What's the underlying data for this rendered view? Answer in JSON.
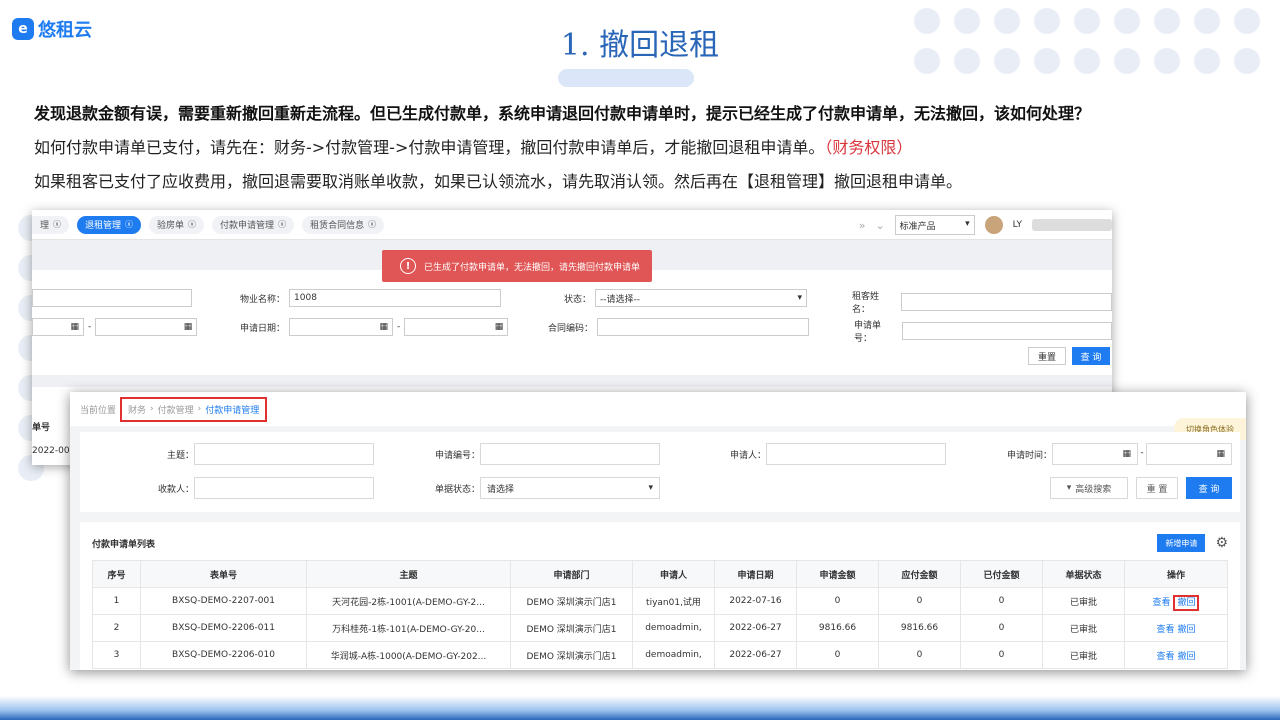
{
  "brand": {
    "logo_mark": "e",
    "name": "悠租云"
  },
  "slide": {
    "title": "1. 撤回退租",
    "question": "发现退款金额有误，需要重新撤回重新走流程。但已生成付款单，系统申请退回付款申请单时，提示已经生成了付款申请单，无法撤回，该如何处理？",
    "answer1_text": "如何付款申请单已支付，请先在：财务->付款管理->付款申请管理，撤回付款申请单后，才能撤回退租申请单。",
    "answer1_note": "（财务权限）",
    "answer2": "如果租客已支付了应收费用，撤回退需要取消账单收款，如果已认领流水，请先取消认领。然后再在【退租管理】撤回退租申请单。"
  },
  "colors": {
    "accent": "#1f7cf0",
    "title_blue": "#2a66b8",
    "error_red": "#e05555",
    "highlight_red": "#e03030"
  },
  "back_screen": {
    "tabs": [
      {
        "label": "理",
        "active": false
      },
      {
        "label": "退租管理",
        "active": true
      },
      {
        "label": "验房单",
        "active": false
      },
      {
        "label": "付款申请管理",
        "active": false
      },
      {
        "label": "租赁合同信息",
        "active": false
      }
    ],
    "product_select": "标准产品",
    "user_name": "LY",
    "toast": "已生成了付款申请单，无法撤回，请先撤回付款申请单",
    "filters": {
      "property_label": "物业名称：",
      "property_value": "1008",
      "status_label": "状态：",
      "status_value": "--请选择--",
      "tenant_label": "租客姓名：",
      "apply_date_label": "申请日期：",
      "contract_label": "合同编码：",
      "apply_no_label": "申请单号："
    },
    "reset_label": "重置",
    "query_label": "查 询",
    "col_label": "单号",
    "row_value": "2022-00"
  },
  "front_screen": {
    "breadcrumb": {
      "prefix": "当前位置",
      "items": [
        "财务",
        "付款管理"
      ],
      "current": "付款申请管理"
    },
    "role_chip": "切换角色体验",
    "filters": {
      "subject_label": "主题：",
      "apply_no_label": "申请编号：",
      "applicant_label": "申请人：",
      "apply_time_label": "申请时间：",
      "payee_label": "收款人：",
      "doc_status_label": "单据状态：",
      "doc_status_value": "请选择"
    },
    "advanced_label": "高级搜索",
    "reset_label": "重 置",
    "query_label": "查 询",
    "list_title": "付款申请单列表",
    "new_label": "新增申请",
    "columns": [
      "序号",
      "表单号",
      "主题",
      "申请部门",
      "申请人",
      "申请日期",
      "申请金额",
      "应付金额",
      "已付金额",
      "单据状态",
      "操作"
    ],
    "rows": [
      {
        "no": "1",
        "form_no": "BXSQ-DEMO-2207-001",
        "subject": "天河花园-2栋-1001(A-DEMO-GY-2...",
        "dept": "DEMO 深圳演示门店1",
        "applicant": "tiyan01,试用",
        "date": "2022-07-16",
        "apply_amt": "0",
        "payable": "0",
        "paid": "0",
        "status": "已审批",
        "view": "查看",
        "withdraw": "撤回"
      },
      {
        "no": "2",
        "form_no": "BXSQ-DEMO-2206-011",
        "subject": "万科桂苑-1栋-101(A-DEMO-GY-20...",
        "dept": "DEMO 深圳演示门店1",
        "applicant": "demoadmin,",
        "date": "2022-06-27",
        "apply_amt": "9816.66",
        "payable": "9816.66",
        "paid": "0",
        "status": "已审批",
        "view": "查看",
        "withdraw": "撤回"
      },
      {
        "no": "3",
        "form_no": "BXSQ-DEMO-2206-010",
        "subject": "华润城-A栋-1000(A-DEMO-GY-202...",
        "dept": "DEMO 深圳演示门店1",
        "applicant": "demoadmin,",
        "date": "2022-06-27",
        "apply_amt": "0",
        "payable": "0",
        "paid": "0",
        "status": "已审批",
        "view": "查看",
        "withdraw": "撤回"
      }
    ]
  }
}
